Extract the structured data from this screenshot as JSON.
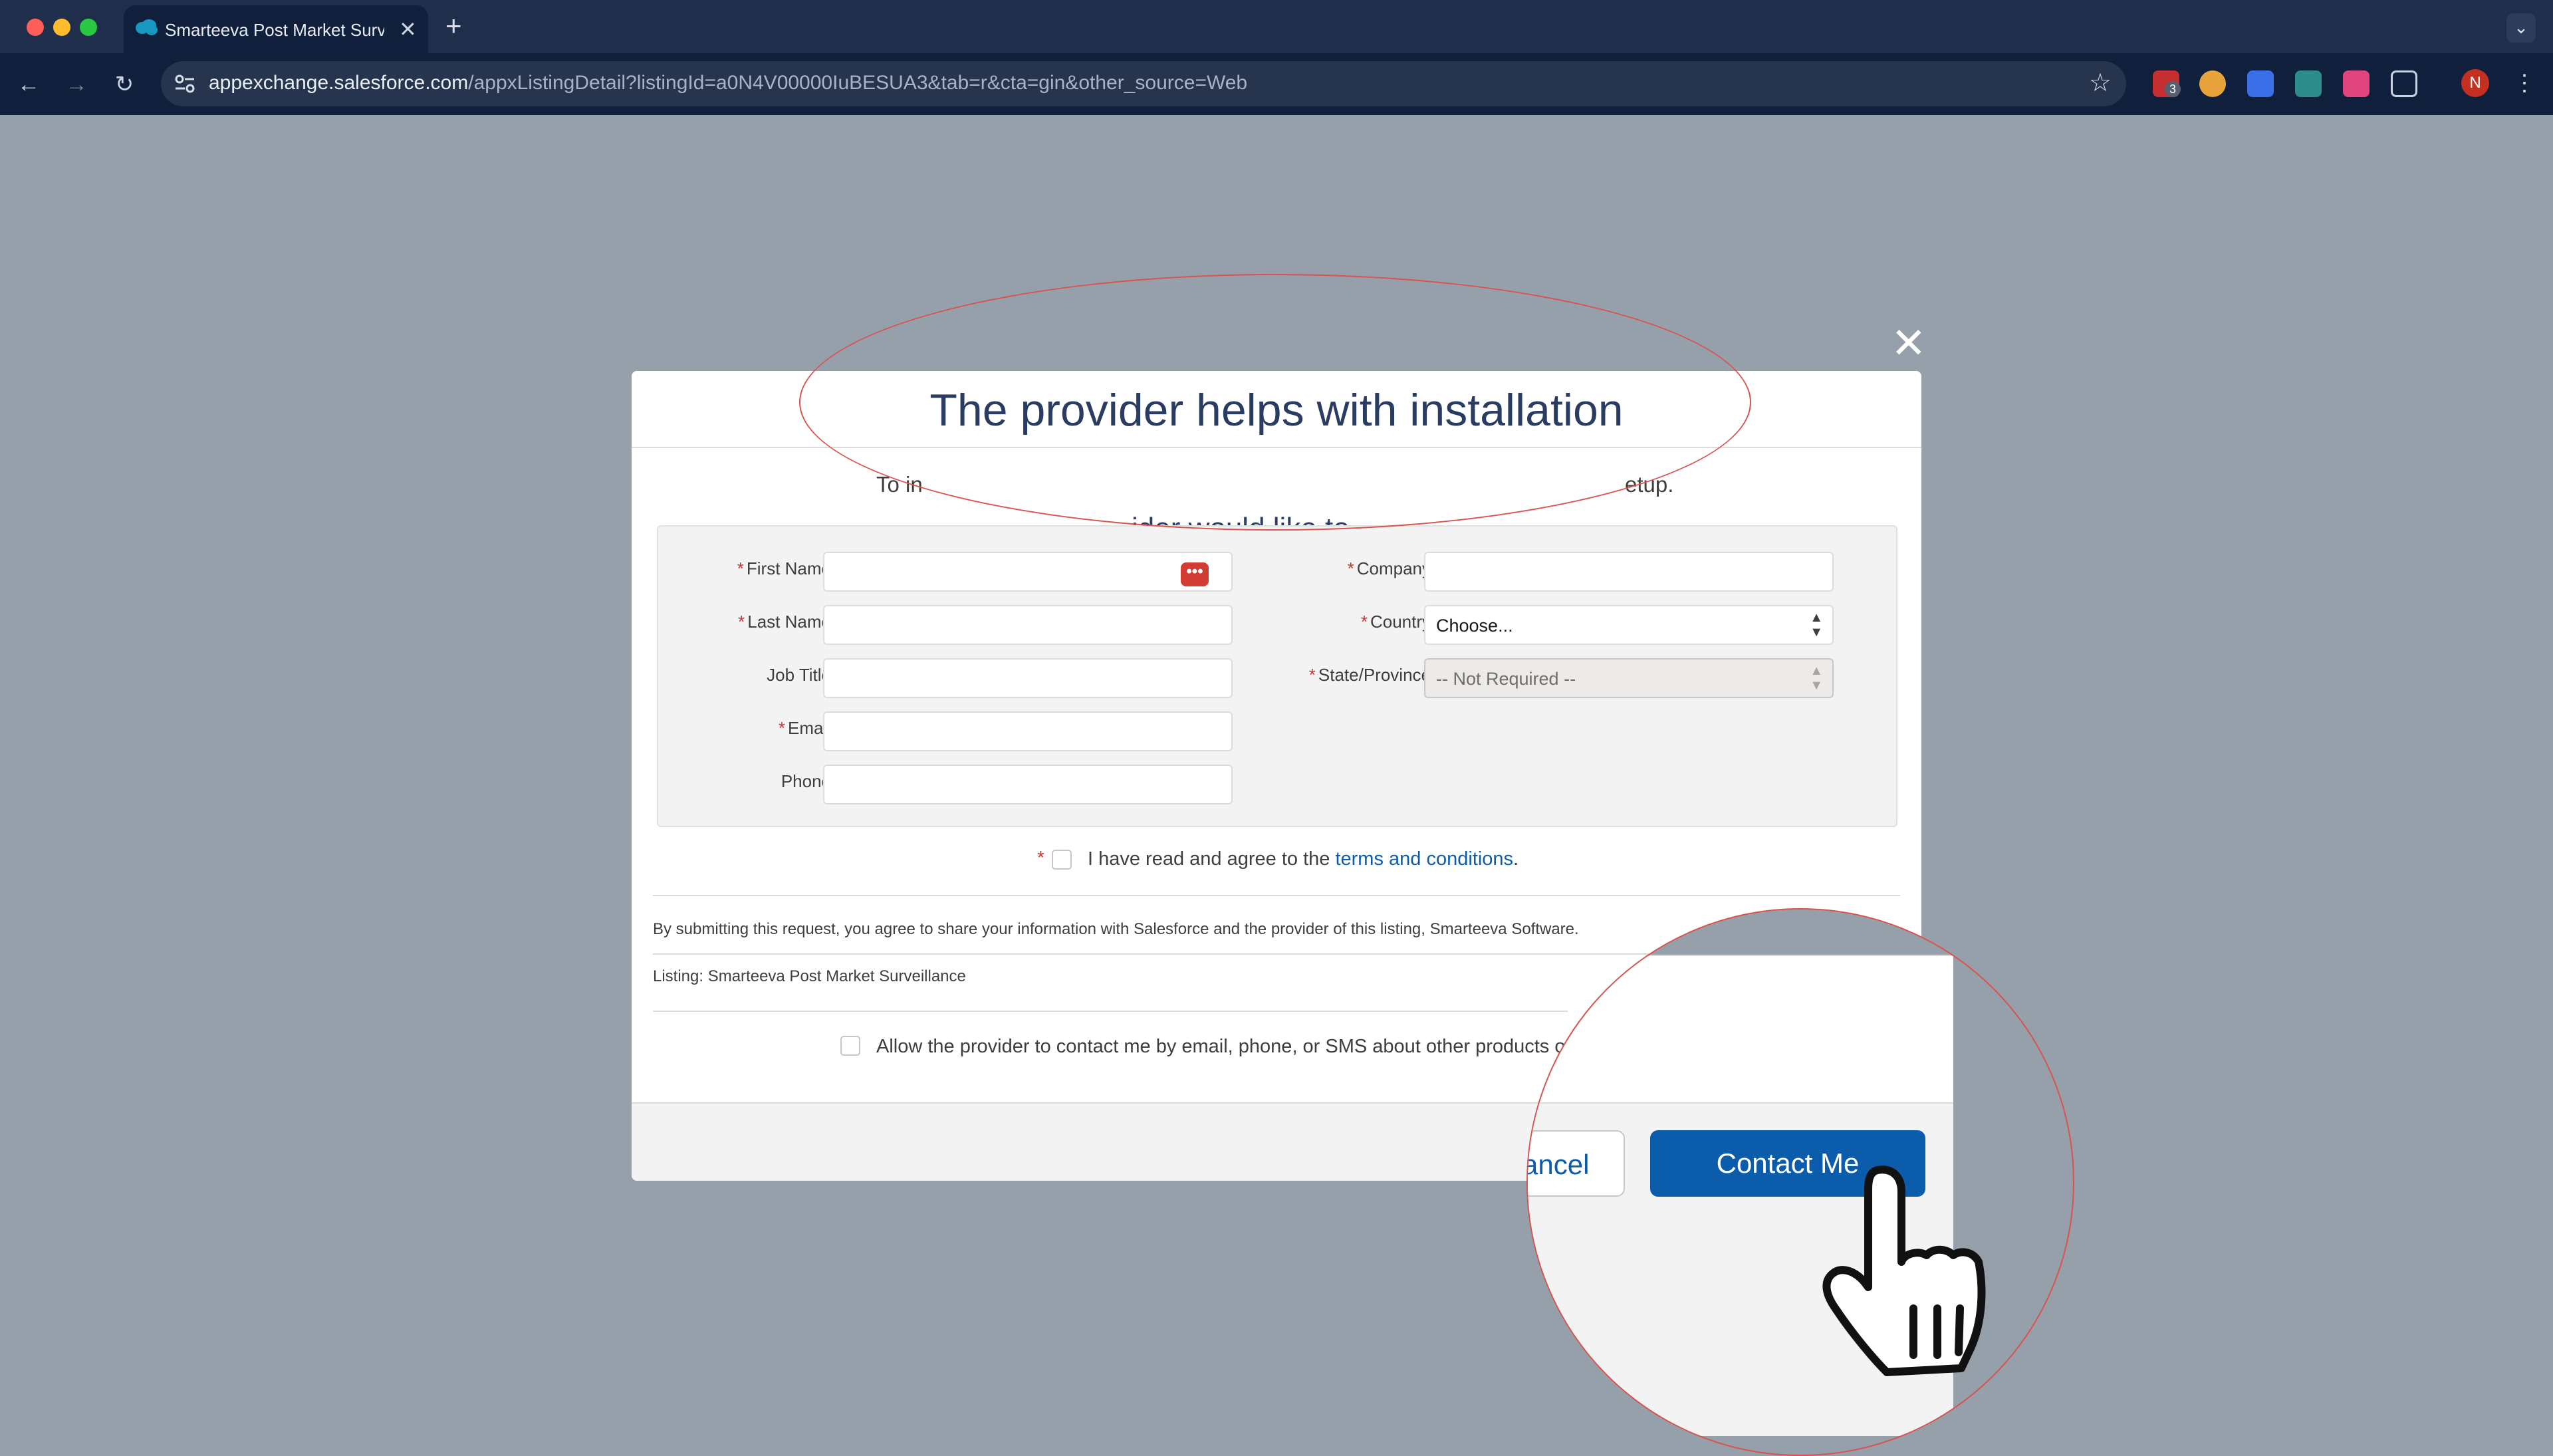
{
  "browser": {
    "tab_title": "Smarteeva Post Market Surveillance",
    "tab_close": "✕",
    "new_tab": "+",
    "tab_menu": "⌄",
    "url_host": "appexchange.salesforce.com",
    "url_path": "/appxListingDetail?listingId=a0N4V00000IuBESUA3&tab=r&cta=gin&other_source=Web",
    "icons": [
      "back-icon",
      "forward-icon",
      "reload-icon",
      "site-info-icon",
      "bookmark-star-icon",
      "extensions-icon",
      "kebab-menu-icon"
    ],
    "extension_badge": "3",
    "profile_initial": "N",
    "colors": {
      "chrome": "#1f2e4a",
      "toolbar": "#0f1f3c"
    }
  },
  "modal": {
    "close": "✕",
    "title": "The provider helps with installation",
    "intro_fragment_left": "To in",
    "intro_fragment_right": "etup.",
    "intro2_fragment": "ider would like to",
    "fields": {
      "first_name": "First Name",
      "last_name": "Last Name",
      "job_title": "Job Title",
      "email": "Email",
      "phone": "Phone",
      "company": "Company",
      "country": "Country",
      "state": "State/Province",
      "country_value": "Choose...",
      "state_value": "-- Not Required --"
    },
    "required_mark": "*",
    "terms_prefix": "I have read and agree to the ",
    "terms_link": "terms and conditions",
    "terms_suffix": ".",
    "disclaimer": "By submitting this request, you agree to share your information with Salesforce and the provider of this listing, Smarteeva Software.",
    "listing": "Listing: Smarteeva Post Market Surveillance",
    "consent": "Allow the provider to contact me by email, phone, or SMS about other products or ser",
    "colors": {
      "primary": "#0b5cab",
      "required": "#c23934",
      "title": "#2a3c61"
    }
  },
  "lens": {
    "heading_fragment": "e",
    "cancel_label": "ancel",
    "contact_label": "Contact Me"
  }
}
